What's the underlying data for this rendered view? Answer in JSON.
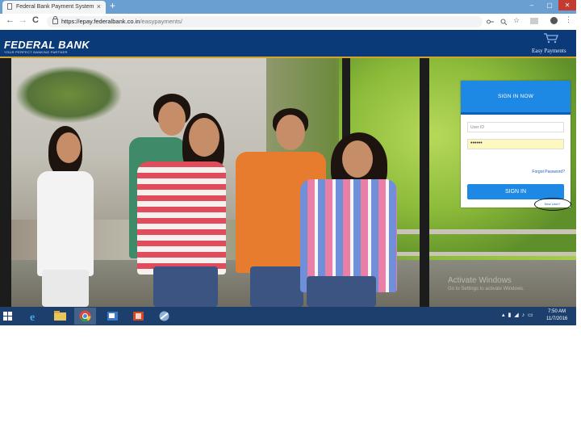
{
  "browser": {
    "tab_title": "Federal Bank Payment System",
    "tab_close": "×",
    "new_tab": "+",
    "window_controls": {
      "minimize": "–",
      "maximize": "▢",
      "close": "✕"
    },
    "nav": {
      "back": "←",
      "forward": "→",
      "reload": "C"
    },
    "url_secure_part": "https://epay.federalbank.co.in",
    "url_path_part": "/easypayments/"
  },
  "site": {
    "brand_name": "FEDERAL BANK",
    "tagline": "YOUR PERFECT BANKING PARTNER",
    "product_name": "Easy Payments"
  },
  "signin": {
    "title": "SIGN IN NOW",
    "userid_placeholder": "User ID",
    "password_value": "••••••",
    "forgot_password": "Forgot Password?",
    "signin_button": "SIGN IN",
    "new_user": "New User?"
  },
  "watermark": {
    "line1": "Activate Windows",
    "line2": "Go to Settings to activate Windows."
  },
  "taskbar": {
    "time": "7:50 AM",
    "date": "11/7/2016"
  },
  "colors": {
    "header_blue": "#0b3a79",
    "accent_blue": "#1e88e5",
    "taskbar": "#1c3f6e"
  }
}
